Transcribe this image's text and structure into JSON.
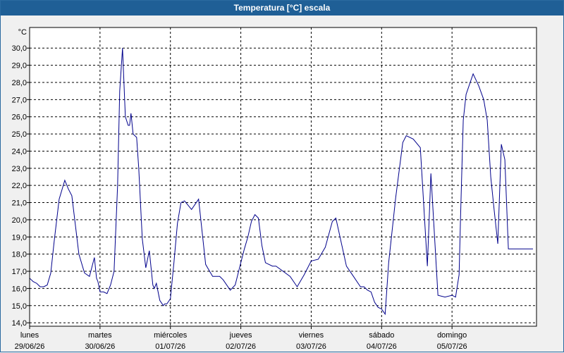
{
  "window": {
    "title": "Temperatura [°C] escala"
  },
  "chart_data": {
    "type": "line",
    "title": "Temperatura [°C] escala",
    "ylabel": "°C",
    "ylim": [
      13.8,
      31.2
    ],
    "xlim": [
      0,
      7.2
    ],
    "grid": true,
    "colors": {
      "line": "#00008b",
      "grid": "#000000",
      "plot_bg": "#ffffff"
    },
    "y_ticks": [
      "14,0",
      "15,0",
      "16,0",
      "17,0",
      "18,0",
      "19,0",
      "20,0",
      "21,0",
      "22,0",
      "23,0",
      "24,0",
      "25,0",
      "26,0",
      "27,0",
      "28,0",
      "29,0",
      "30,0"
    ],
    "x_ticks": [
      {
        "day": "lunes",
        "date": "29/06/26"
      },
      {
        "day": "martes",
        "date": "30/06/26"
      },
      {
        "day": "miércoles",
        "date": "01/07/26"
      },
      {
        "day": "jueves",
        "date": "02/07/26"
      },
      {
        "day": "viernes",
        "date": "03/07/26"
      },
      {
        "day": "sábado",
        "date": "04/07/26"
      },
      {
        "day": "domingo",
        "date": "05/07/26"
      }
    ],
    "series": [
      {
        "x": [
          0,
          0.05,
          0.1,
          0.15,
          0.2,
          0.25,
          0.3,
          0.35,
          0.42,
          0.5,
          0.55,
          0.6,
          0.7,
          0.78,
          0.85,
          0.92,
          0.95,
          0.97,
          1.0,
          1.05,
          1.1,
          1.15,
          1.2,
          1.25,
          1.28,
          1.32,
          1.36,
          1.4,
          1.42,
          1.44,
          1.47,
          1.52,
          1.55,
          1.6,
          1.65,
          1.7,
          1.75,
          1.77,
          1.8,
          1.85,
          1.9,
          1.92,
          1.95,
          2.0,
          2.05,
          2.1,
          2.15,
          2.2,
          2.3,
          2.4,
          2.5,
          2.6,
          2.7,
          2.75,
          2.85,
          2.92,
          3.0,
          3.05,
          3.1,
          3.15,
          3.2,
          3.25,
          3.3,
          3.35,
          3.4,
          3.45,
          3.5,
          3.6,
          3.7,
          3.8,
          3.9,
          4.0,
          4.1,
          4.2,
          4.3,
          4.35,
          4.5,
          4.6,
          4.7,
          4.75,
          4.8,
          4.85,
          4.9,
          4.95,
          5.0,
          5.05,
          5.1,
          5.2,
          5.3,
          5.35,
          5.45,
          5.55,
          5.65,
          5.7,
          5.8,
          5.9,
          6.0,
          6.05,
          6.1,
          6.12,
          6.14,
          6.16,
          6.2,
          6.3,
          6.38,
          6.45,
          6.5,
          6.55,
          6.6,
          6.65,
          6.7,
          6.75,
          6.8,
          6.85,
          6.9,
          6.95,
          7.0,
          7.05,
          7.08,
          7.1,
          7.15
        ],
        "values": [
          16.6,
          16.4,
          16.3,
          16.1,
          16.1,
          16.2,
          16.9,
          18.8,
          21.2,
          22.3,
          21.8,
          21.4,
          18.0,
          16.9,
          16.7,
          17.8,
          16.6,
          16.4,
          15.8,
          15.8,
          15.7,
          16.2,
          17.0,
          22.0,
          27.5,
          30.0,
          26.0,
          25.5,
          25.5,
          26.2,
          25.0,
          24.8,
          23.0,
          18.9,
          17.2,
          18.2,
          16.2,
          16.0,
          16.3,
          15.3,
          15.0,
          15.1,
          15.1,
          15.4,
          17.5,
          19.8,
          21.0,
          21.1,
          20.6,
          21.2,
          17.4,
          16.7,
          16.7,
          16.5,
          15.9,
          16.2,
          17.5,
          18.3,
          19.0,
          19.9,
          20.3,
          20.1,
          18.5,
          17.5,
          17.4,
          17.3,
          17.3,
          17.0,
          16.7,
          16.1,
          16.8,
          17.6,
          17.7,
          18.4,
          19.9,
          20.1,
          17.3,
          16.7,
          16.1,
          16.1,
          15.9,
          15.8,
          15.2,
          14.9,
          14.8,
          14.5,
          17.5,
          21.3,
          24.5,
          24.9,
          24.7,
          24.2,
          17.3,
          22.7,
          15.6,
          15.5,
          15.6,
          15.5,
          16.8,
          19.9,
          22.9,
          25.8,
          27.3,
          28.5,
          27.8,
          27.0,
          25.8,
          22.5,
          20.5,
          18.6,
          24.4,
          23.5,
          18.3,
          18.3,
          18.3,
          18.3,
          18.3,
          18.3,
          18.3,
          18.3,
          18.3
        ]
      }
    ]
  }
}
